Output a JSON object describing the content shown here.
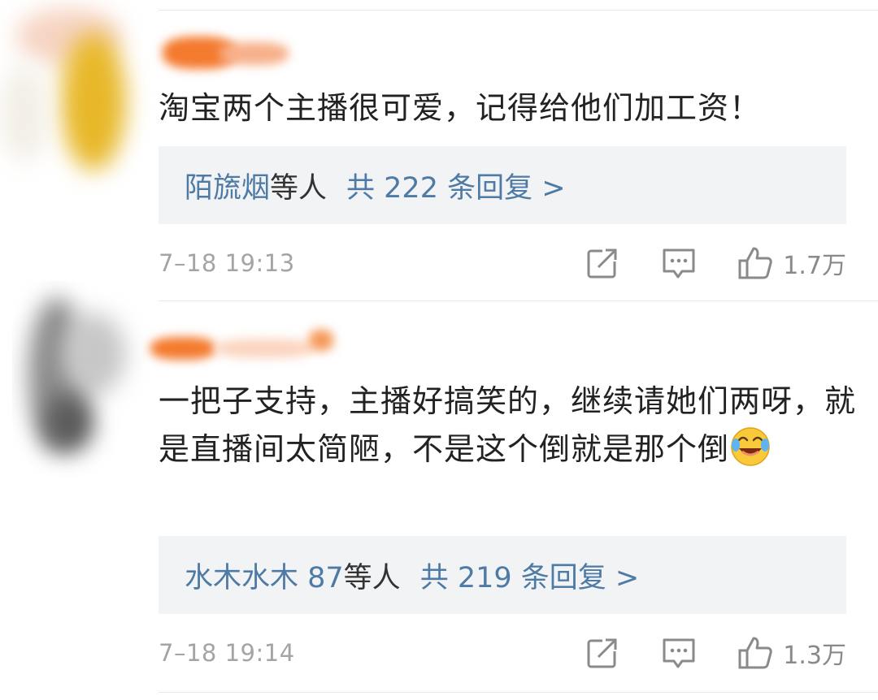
{
  "comments": [
    {
      "text": "淘宝两个主播很可爱，记得给他们加工资！",
      "reply_users": "陌旒烟",
      "reply_etc": "等人",
      "reply_count": "共 222 条回复 >",
      "timestamp": "7–18 19:13",
      "likes": "1.7万"
    },
    {
      "text": "一把子支持，主播好搞笑的，继续请她们两呀，就是直播间太简陋，不是这个倒就是那个倒",
      "reply_users": "水木水木 87",
      "reply_etc": "等人",
      "reply_count": "共 219 条回复 >",
      "timestamp": "7–18 19:14",
      "likes": "1.3万"
    }
  ],
  "icons": {
    "repost": "repost-icon",
    "reply": "comment-icon",
    "like": "thumbs-up-icon",
    "emoji": "laughing-tears-emoji-icon"
  },
  "colors": {
    "link_blue": "#4e7aa6",
    "text": "#222222",
    "meta_gray": "#a4a4a4",
    "reply_bg": "#f2f3f5",
    "username_smudge": "#f47a2e"
  }
}
